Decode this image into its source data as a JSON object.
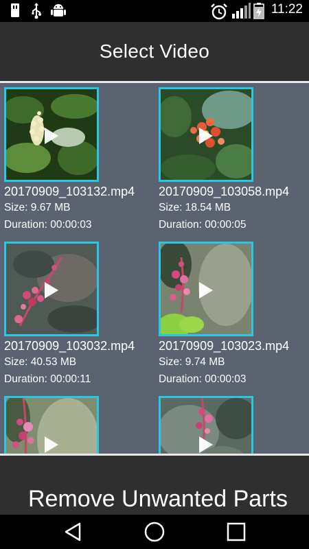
{
  "status_bar": {
    "time": "11:22",
    "left_icons": [
      "usb-storage-icon",
      "usb-icon",
      "android-debug-icon"
    ],
    "right_icons": [
      "alarm-clock-icon",
      "signal-icon",
      "battery-charging-icon"
    ]
  },
  "header": {
    "title": "Select Video"
  },
  "videos": [
    {
      "name": "20170909_103132.mp4",
      "size": "Size: 9.67 MB",
      "duration": "Duration: 00:00:03"
    },
    {
      "name": "20170909_103058.mp4",
      "size": "Size: 18.54 MB",
      "duration": "Duration: 00:00:05"
    },
    {
      "name": "20170909_103032.mp4",
      "size": "Size: 40.53 MB",
      "duration": "Duration: 00:00:11"
    },
    {
      "name": "20170909_103023.mp4",
      "size": "Size: 9.74 MB",
      "duration": "Duration: 00:00:03"
    },
    {
      "name": "",
      "size": "",
      "duration": ""
    },
    {
      "name": "",
      "size": "",
      "duration": ""
    }
  ],
  "footer": {
    "button_label": "Remove Unwanted Parts"
  },
  "nav": {
    "back_icon": "back-triangle-icon",
    "home_icon": "home-circle-icon",
    "recents_icon": "recents-square-icon"
  },
  "colors": {
    "accent": "#27c7e6",
    "bar_bg": "#2f2f2f",
    "list_bg": "#5c6370"
  }
}
